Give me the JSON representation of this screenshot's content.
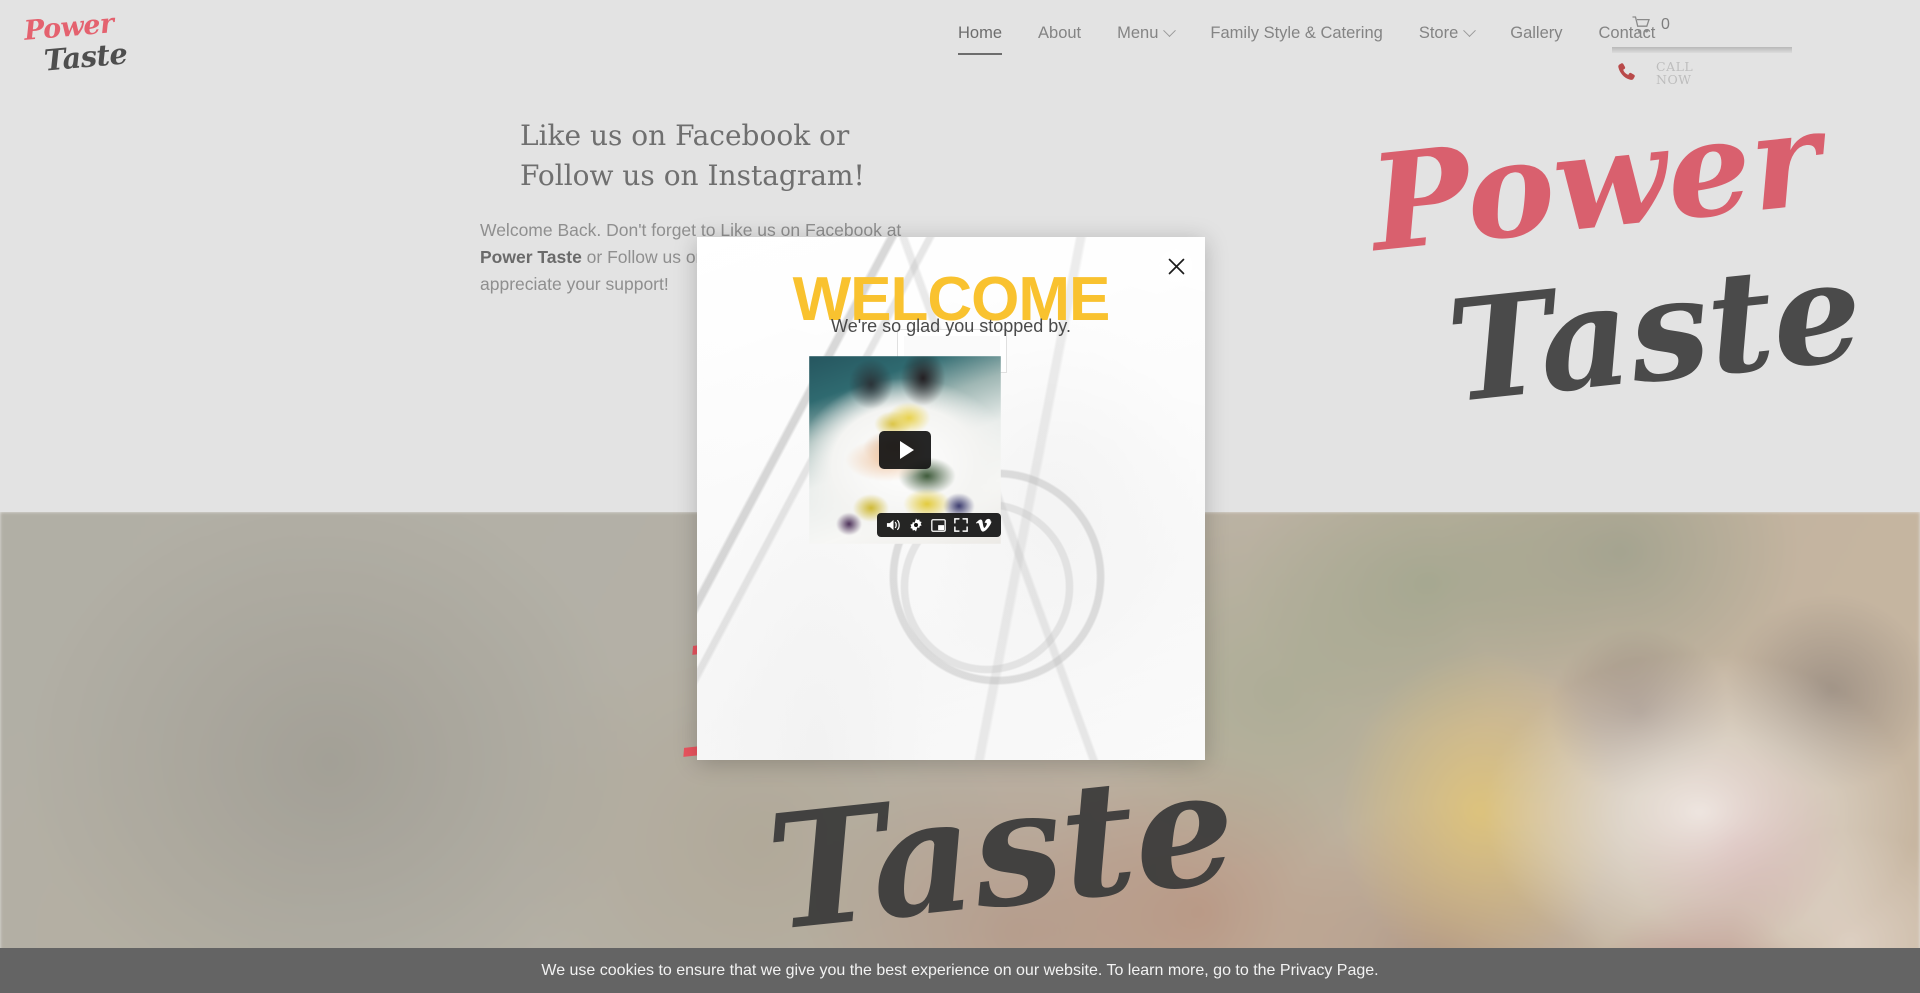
{
  "header": {
    "logo": {
      "line1": "Power",
      "line2": "Taste",
      "color_primary": "#e4626f",
      "color_secondary": "#4e4e4e"
    },
    "nav": [
      {
        "label": "Home",
        "has_caret": false,
        "active": true
      },
      {
        "label": "About",
        "has_caret": false,
        "active": false
      },
      {
        "label": "Menu",
        "has_caret": true,
        "active": false
      },
      {
        "label": "Family Style & Catering",
        "has_caret": false,
        "active": false
      },
      {
        "label": "Store",
        "has_caret": true,
        "active": false
      },
      {
        "label": "Gallery",
        "has_caret": false,
        "active": false
      },
      {
        "label": "Contact",
        "has_caret": false,
        "active": false
      }
    ],
    "cart": {
      "icon": "shopping-cart-icon",
      "count": "0"
    },
    "call_now": {
      "icon": "phone-icon",
      "line1": "CALL",
      "line2": "NOW"
    }
  },
  "intro": {
    "heading": "Like us on Facebook or Follow us on Instagram!",
    "para_part1": "Welcome Back. Don't forget to Like us on Facebook at ",
    "para_brand": "Power Taste",
    "para_part2": " or Follow us on Instagram @powertaste. We appreciate your support!",
    "watermark": {
      "line1": "Power",
      "line2": "Taste"
    }
  },
  "hero": {
    "logo": {
      "line1": "Power",
      "line2": "Taste"
    }
  },
  "modal": {
    "title": "WELCOME",
    "title_color": "#f9c22f",
    "subtitle": "We're so glad you stopped by.",
    "close_icon": "close-icon",
    "video": {
      "play_icon": "play-icon",
      "controls": [
        {
          "name": "volume-icon"
        },
        {
          "name": "settings-gear-icon"
        },
        {
          "name": "picture-in-picture-icon"
        },
        {
          "name": "fullscreen-icon"
        },
        {
          "name": "vimeo-logo-icon"
        }
      ]
    }
  },
  "cookie_banner": {
    "text_before_link": "We use cookies to ensure that we give you the best experience on our website. To learn more, go to the ",
    "link_label": "Privacy Page",
    "text_after_link": ".",
    "background": "#646464"
  }
}
